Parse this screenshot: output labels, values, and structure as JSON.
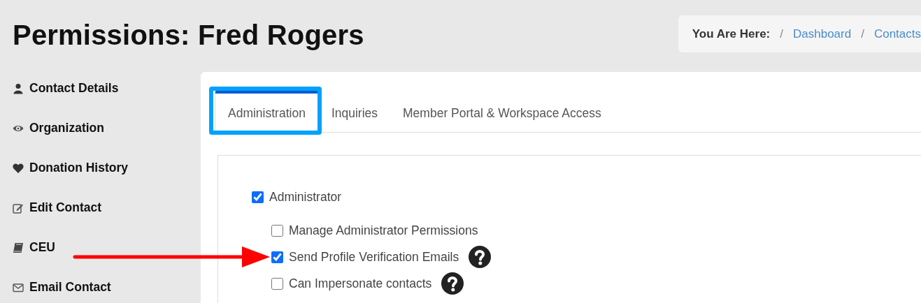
{
  "page_title": "Permissions: Fred Rogers",
  "breadcrumb": {
    "label": "You Are Here:",
    "items": [
      {
        "separator": "/",
        "text": "Dashboard"
      },
      {
        "separator": "/",
        "text": "Contacts"
      }
    ]
  },
  "sidebar": {
    "items": [
      {
        "label": "Contact Details"
      },
      {
        "label": "Organization"
      },
      {
        "label": "Donation History"
      },
      {
        "label": "Edit Contact"
      },
      {
        "label": "CEU"
      },
      {
        "label": "Email Contact"
      }
    ]
  },
  "tabs": [
    {
      "label": "Administration",
      "selected": true
    },
    {
      "label": "Inquiries",
      "selected": false
    },
    {
      "label": "Member Portal & Workspace Access",
      "selected": false
    }
  ],
  "permissions": [
    {
      "label": "Administrator",
      "checked": true,
      "help": false,
      "children": [
        {
          "label": "Manage Administrator Permissions",
          "checked": false,
          "help": false
        },
        {
          "label": "Send Profile Verification Emails",
          "checked": true,
          "help": true
        },
        {
          "label": "Can Impersonate contacts",
          "checked": false,
          "help": true
        }
      ]
    }
  ],
  "annotations": [
    {
      "kind": "box",
      "color": "#00a2ff"
    },
    {
      "kind": "arrow",
      "color": "#ff0000"
    }
  ]
}
